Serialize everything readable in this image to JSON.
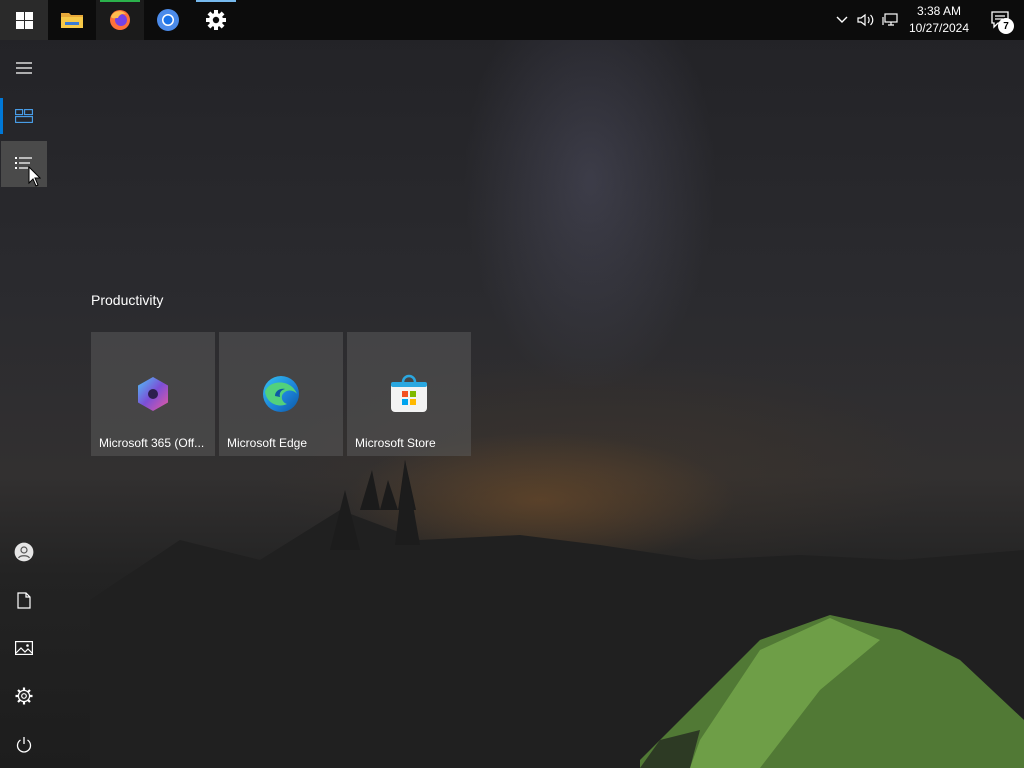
{
  "taskbar": {
    "start_icon": "windows-logo-icon",
    "pinned": [
      {
        "name": "File Explorer",
        "icon": "file-explorer-icon"
      },
      {
        "name": "Firefox",
        "icon": "firefox-icon"
      },
      {
        "name": "Chromium",
        "icon": "chromium-icon"
      },
      {
        "name": "Settings",
        "icon": "settings-gear-icon"
      }
    ],
    "tray": {
      "icons": [
        "chevron-up-icon",
        "volume-icon",
        "network-icon"
      ],
      "time": "3:38 AM",
      "date": "10/27/2024",
      "notification_count": "7"
    }
  },
  "start_menu": {
    "rail_top": [
      "hamburger-menu-icon",
      "pinned-tiles-icon",
      "all-apps-list-icon"
    ],
    "rail_bottom": [
      "user-account-icon",
      "documents-icon",
      "pictures-icon",
      "settings-icon",
      "power-icon"
    ],
    "group_title": "Productivity",
    "tiles": [
      {
        "label": "Microsoft 365 (Off...",
        "icon": "microsoft-365-icon"
      },
      {
        "label": "Microsoft Edge",
        "icon": "microsoft-edge-icon"
      },
      {
        "label": "Microsoft Store",
        "icon": "microsoft-store-icon"
      }
    ]
  },
  "colors": {
    "accent": "#0078d7",
    "taskbar": "#0c0c0c",
    "tile": "#5a5a5a"
  }
}
